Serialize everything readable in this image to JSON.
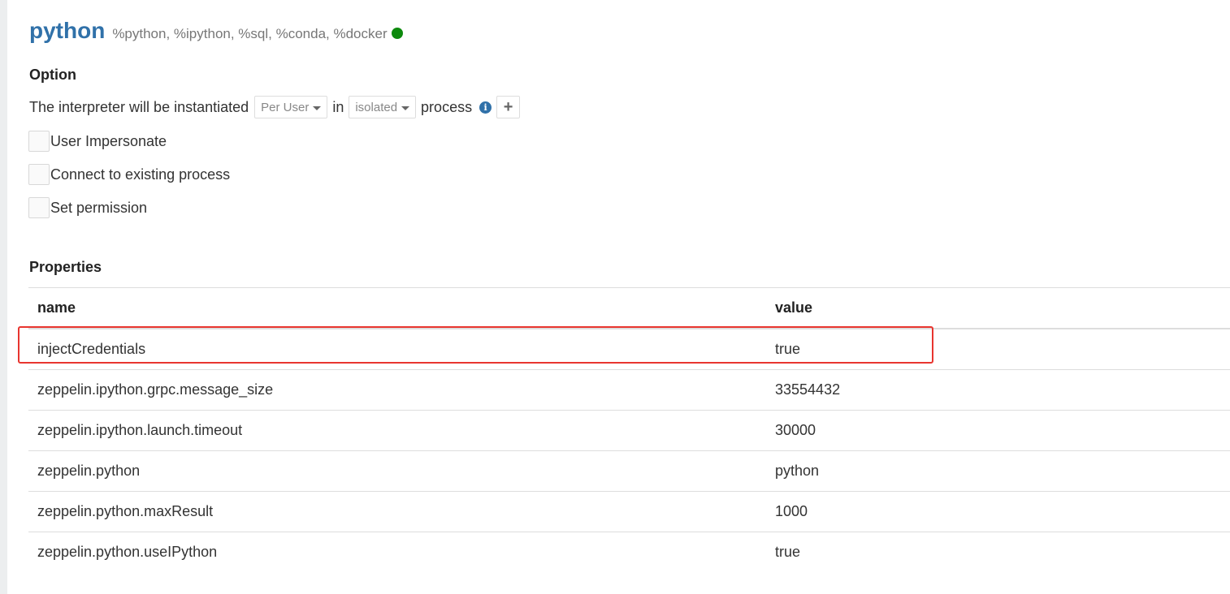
{
  "interpreter": {
    "name": "python",
    "bindings": "%python, %ipython, %sql, %conda, %docker",
    "status_color": "#0d8a0d"
  },
  "option": {
    "heading": "Option",
    "instantiate_prefix": "The interpreter will be instantiated",
    "scope_value": "Per User",
    "in_label": "in",
    "mode_value": "isolated",
    "process_label": "process",
    "info_icon": "i",
    "add_icon": "+",
    "checkboxes": [
      {
        "label": "User Impersonate",
        "checked": false
      },
      {
        "label": "Connect to existing process",
        "checked": false
      },
      {
        "label": "Set permission",
        "checked": false
      }
    ]
  },
  "properties": {
    "heading": "Properties",
    "columns": {
      "name": "name",
      "value": "value"
    },
    "rows": [
      {
        "name": "injectCredentials",
        "value": "true"
      },
      {
        "name": "zeppelin.ipython.grpc.message_size",
        "value": "33554432"
      },
      {
        "name": "zeppelin.ipython.launch.timeout",
        "value": "30000"
      },
      {
        "name": "zeppelin.python",
        "value": "python"
      },
      {
        "name": "zeppelin.python.maxResult",
        "value": "1000"
      },
      {
        "name": "zeppelin.python.useIPython",
        "value": "true"
      }
    ]
  },
  "colors": {
    "accent": "#3071a9",
    "highlight": "#e8352f"
  }
}
